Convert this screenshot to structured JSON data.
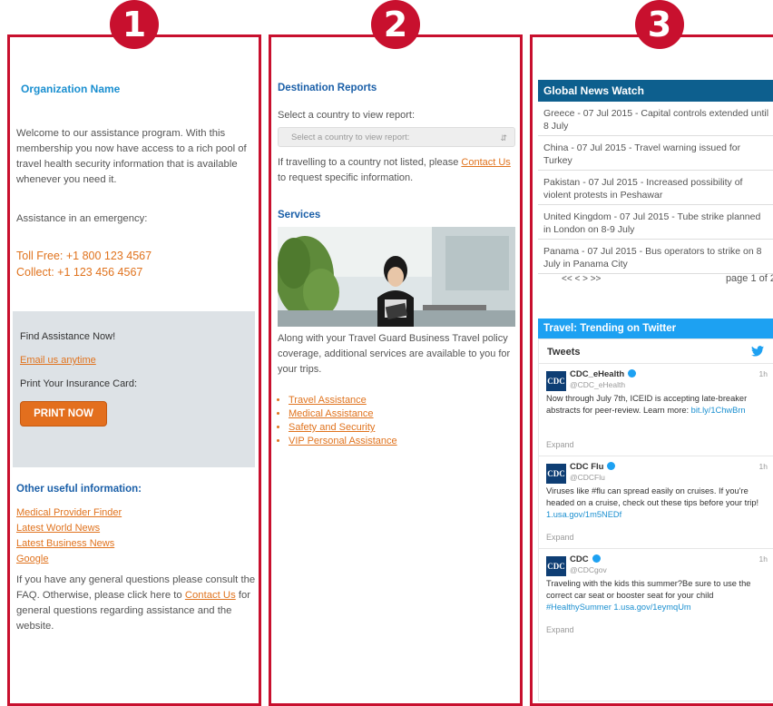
{
  "badges": [
    "1",
    "2",
    "3"
  ],
  "panel1": {
    "org_name": "Organization Name",
    "welcome_text": "Welcome to our assistance program. With this membership you now have access to a rich pool of travel health security information that is available whenever you need it.",
    "emergency_label": "Assistance in an emergency:",
    "toll_free": "Toll Free: +1 800 123 4567",
    "collect": "Collect: +1 123 456 4567",
    "assist_box": {
      "title": "Find Assistance Now!",
      "email_link": "Email us anytime",
      "print_label": "Print Your Insurance Card:",
      "print_button": "PRINT NOW"
    },
    "other_title": "Other useful information:",
    "useful_links": [
      "Medical Provider Finder",
      "Latest World News",
      "Latest Business News",
      "Google"
    ],
    "footer_before": "If you have any general questions please consult the FAQ. Otherwise, please click here to ",
    "footer_link": "Contact Us",
    "footer_after": " for general questions regarding assistance and the website."
  },
  "panel2": {
    "dest_title": "Destination Reports",
    "select_label": "Select a country to view report:",
    "select_value": "Select a country to view report:",
    "not_listed_before": "If travelling to a country not listed, please ",
    "not_listed_link": "Contact Us",
    "not_listed_after": " to request specific information.",
    "services_title": "Services",
    "services_text": "Along with your Travel Guard Business Travel policy coverage, additional services are available to you for your trips.",
    "services_list": [
      "Travel Assistance",
      "Medical Assistance",
      "Safety and Security",
      "VIP Personal Assistance"
    ]
  },
  "panel3": {
    "news_title": "Global News Watch",
    "news": [
      "Greece - 07 Jul 2015 - Capital controls extended until 8 July",
      "China - 07 Jul 2015 - Travel warning issued for Turkey",
      "Pakistan - 07 Jul 2015 - Increased possibility of violent protests in Peshawar",
      "United Kingdom - 07 Jul 2015 - Tube strike planned in London on 8-9 July",
      "Panama - 07 Jul 2015 - Bus operators to strike on 8 July in Panama City"
    ],
    "pager_arrows": "<< <  >  >>",
    "page_text": "page 1 of 2",
    "twitter_title": "Travel: Trending on Twitter",
    "tweets_label": "Tweets",
    "tweets": [
      {
        "avatar": "CDC",
        "name": "CDC_eHealth",
        "handle": "@CDC_eHealth",
        "time": "1h",
        "text": "Now through July 7th, ICEID is accepting late-breaker abstracts for peer-review. Learn more: ",
        "link": "bit.ly/1ChwBrn",
        "expand": "Expand"
      },
      {
        "avatar": "CDC",
        "name": "CDC Flu",
        "handle": "@CDCFlu",
        "time": "1h",
        "text": "Viruses like #flu can spread easily on cruises. If you're headed on a cruise, check out these tips before your trip! ",
        "link": "1.usa.gov/1m5NEDf",
        "expand": "Expand"
      },
      {
        "avatar": "CDC",
        "name": "CDC",
        "handle": "@CDCgov",
        "time": "1h",
        "text": "Traveling with the kids this summer?Be sure to use the correct car seat or booster seat for your child ",
        "link": "#HealthySummer 1.usa.gov/1eymqUm",
        "expand": "Expand"
      }
    ]
  }
}
